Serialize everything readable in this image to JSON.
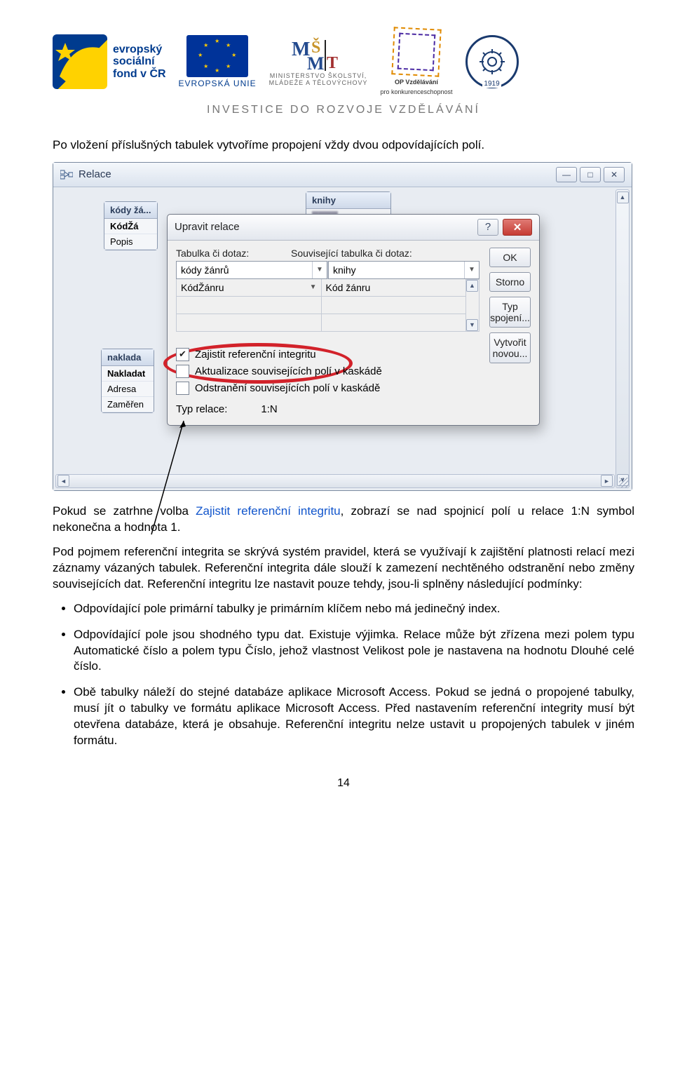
{
  "header": {
    "esf_line1": "evropský",
    "esf_line2": "sociální",
    "esf_line3": "fond v ČR",
    "eu_label": "EVROPSKÁ UNIE",
    "msmt_line1": "MINISTERSTVO ŠKOLSTVÍ,",
    "msmt_line2": "MLÁDEŽE A TĚLOVÝCHOVY",
    "op_line1": "OP Vzdělávání",
    "op_line2": "pro konkurenceschopnost",
    "emblem_year": "1919",
    "investice": "INVESTICE DO ROZVOJE VZDĚLÁVÁNÍ"
  },
  "intro_text": "Po vložení příslušných tabulek vytvoříme propojení vždy dvou odpovídajících polí.",
  "relace_window": {
    "title": "Relace",
    "bg_tables": {
      "kody": {
        "header": "kódy žá...",
        "rows": [
          "KódŽá",
          "Popis"
        ]
      },
      "knihy": {
        "header": "knihy"
      },
      "naklad": {
        "header": "naklada",
        "rows": [
          "Nakladat",
          "Adresa",
          "Zaměřen"
        ]
      }
    },
    "dialog": {
      "title": "Upravit relace",
      "label_left": "Tabulka či dotaz:",
      "label_right": "Související tabulka či dotaz:",
      "combo_left": "kódy žánrů",
      "combo_right": "knihy",
      "field_left": "KódŽánru",
      "field_right": "Kód žánru",
      "chk1": "Zajistit referenční integritu",
      "chk2": "Aktualizace souvisejících polí v kaskádě",
      "chk3": "Odstranění souvisejících polí v kaskádě",
      "typ_label": "Typ relace:",
      "typ_value": "1:N",
      "buttons": {
        "ok": "OK",
        "storno": "Storno",
        "typspoj": "Typ spojení...",
        "vytvorit": "Vytvořit novou..."
      }
    }
  },
  "para2_prefix": "Pokud se zatrhne volba ",
  "para2_blue": "Zajistit referenční integritu",
  "para2_suffix": ", zobrazí se nad spojnicí polí u relace 1:N symbol nekonečna a hodnota 1.",
  "para3": "Pod pojmem referenční integrita se skrývá systém pravidel, která se využívají k zajištění platnosti relací mezi záznamy vázaných tabulek. Referenční integrita dále slouží k zamezení nechtěného odstranění nebo změny souvisejících dat. Referenční integritu lze nastavit pouze tehdy, jsou-li splněny následující podmínky:",
  "bullets": [
    "Odpovídající pole primární tabulky je primárním klíčem nebo má jedinečný index.",
    "Odpovídající pole jsou shodného typu dat. Existuje výjimka. Relace může být zřízena mezi polem typu Automatické číslo a polem typu Číslo, jehož vlastnost Velikost pole je nastavena na hodnotu Dlouhé celé číslo.",
    "Obě tabulky náleží do stejné databáze aplikace Microsoft Access. Pokud se jedná o propojené tabulky, musí jít o tabulky ve formátu aplikace Microsoft Access. Před nastavením referenční integrity musí být otevřena databáze, která je obsahuje. Referenční integritu nelze ustavit u propojených tabulek v jiném formátu."
  ],
  "page_number": "14"
}
